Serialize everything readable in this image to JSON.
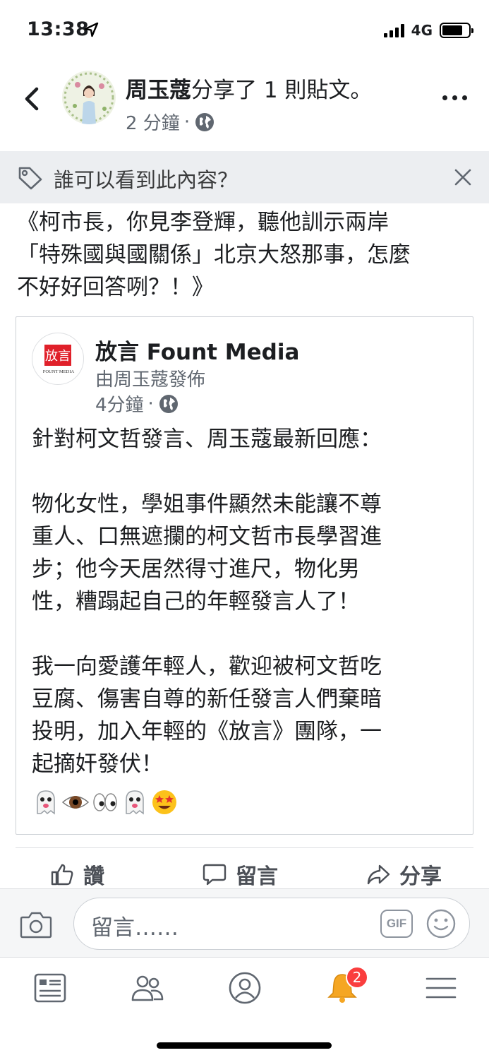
{
  "status_bar": {
    "time": "13:38",
    "network": "4G"
  },
  "post": {
    "author": "周玉蔻",
    "action_text": "分享了 1 則貼文。",
    "time": "2 分鐘",
    "separator": "·",
    "privacy_prompt": "誰可以看到此內容？",
    "text_lines": [
      "《柯市長，你見李登輝，聽他訓示兩岸",
      "「特殊國與國關係」北京大怒那事，怎麼",
      "不好好回答咧？！》"
    ]
  },
  "shared": {
    "page_name": "放言 Fount Media",
    "logo_text": "放言",
    "logo_sub": "FOUNT MEDIA",
    "published_by": "由周玉蔻發佈",
    "time": "4分鐘",
    "separator": "·",
    "paragraphs": [
      [
        "針對柯文哲發言、周玉蔻最新回應："
      ],
      [
        "物化女性，學姐事件顯然未能讓不尊",
        "重人、口無遮攔的柯文哲市長學習進",
        "步；他今天居然得寸進尺，物化男",
        "性，糟蹋起自己的年輕發言人了！"
      ],
      [
        "我一向愛護年輕人，歡迎被柯文哲吃",
        "豆腐、傷害自尊的新任發言人們棄暗",
        "投明，加入年輕的《放言》團隊，一",
        "起摘奸發伏！"
      ]
    ],
    "emojis": [
      "ghost-icon",
      "eye-icon",
      "eyes-icon",
      "ghost-icon",
      "star-struck-icon"
    ]
  },
  "actions": {
    "like": "讚",
    "comment": "留言",
    "share": "分享"
  },
  "comment_bar": {
    "placeholder": "留言……",
    "gif": "GIF"
  },
  "tab_bar": {
    "notification_count": "2"
  },
  "colors": {
    "badge": "#fa3e3e",
    "banner": "#eceef1",
    "text": "#1c1e21",
    "muted": "#606770"
  }
}
